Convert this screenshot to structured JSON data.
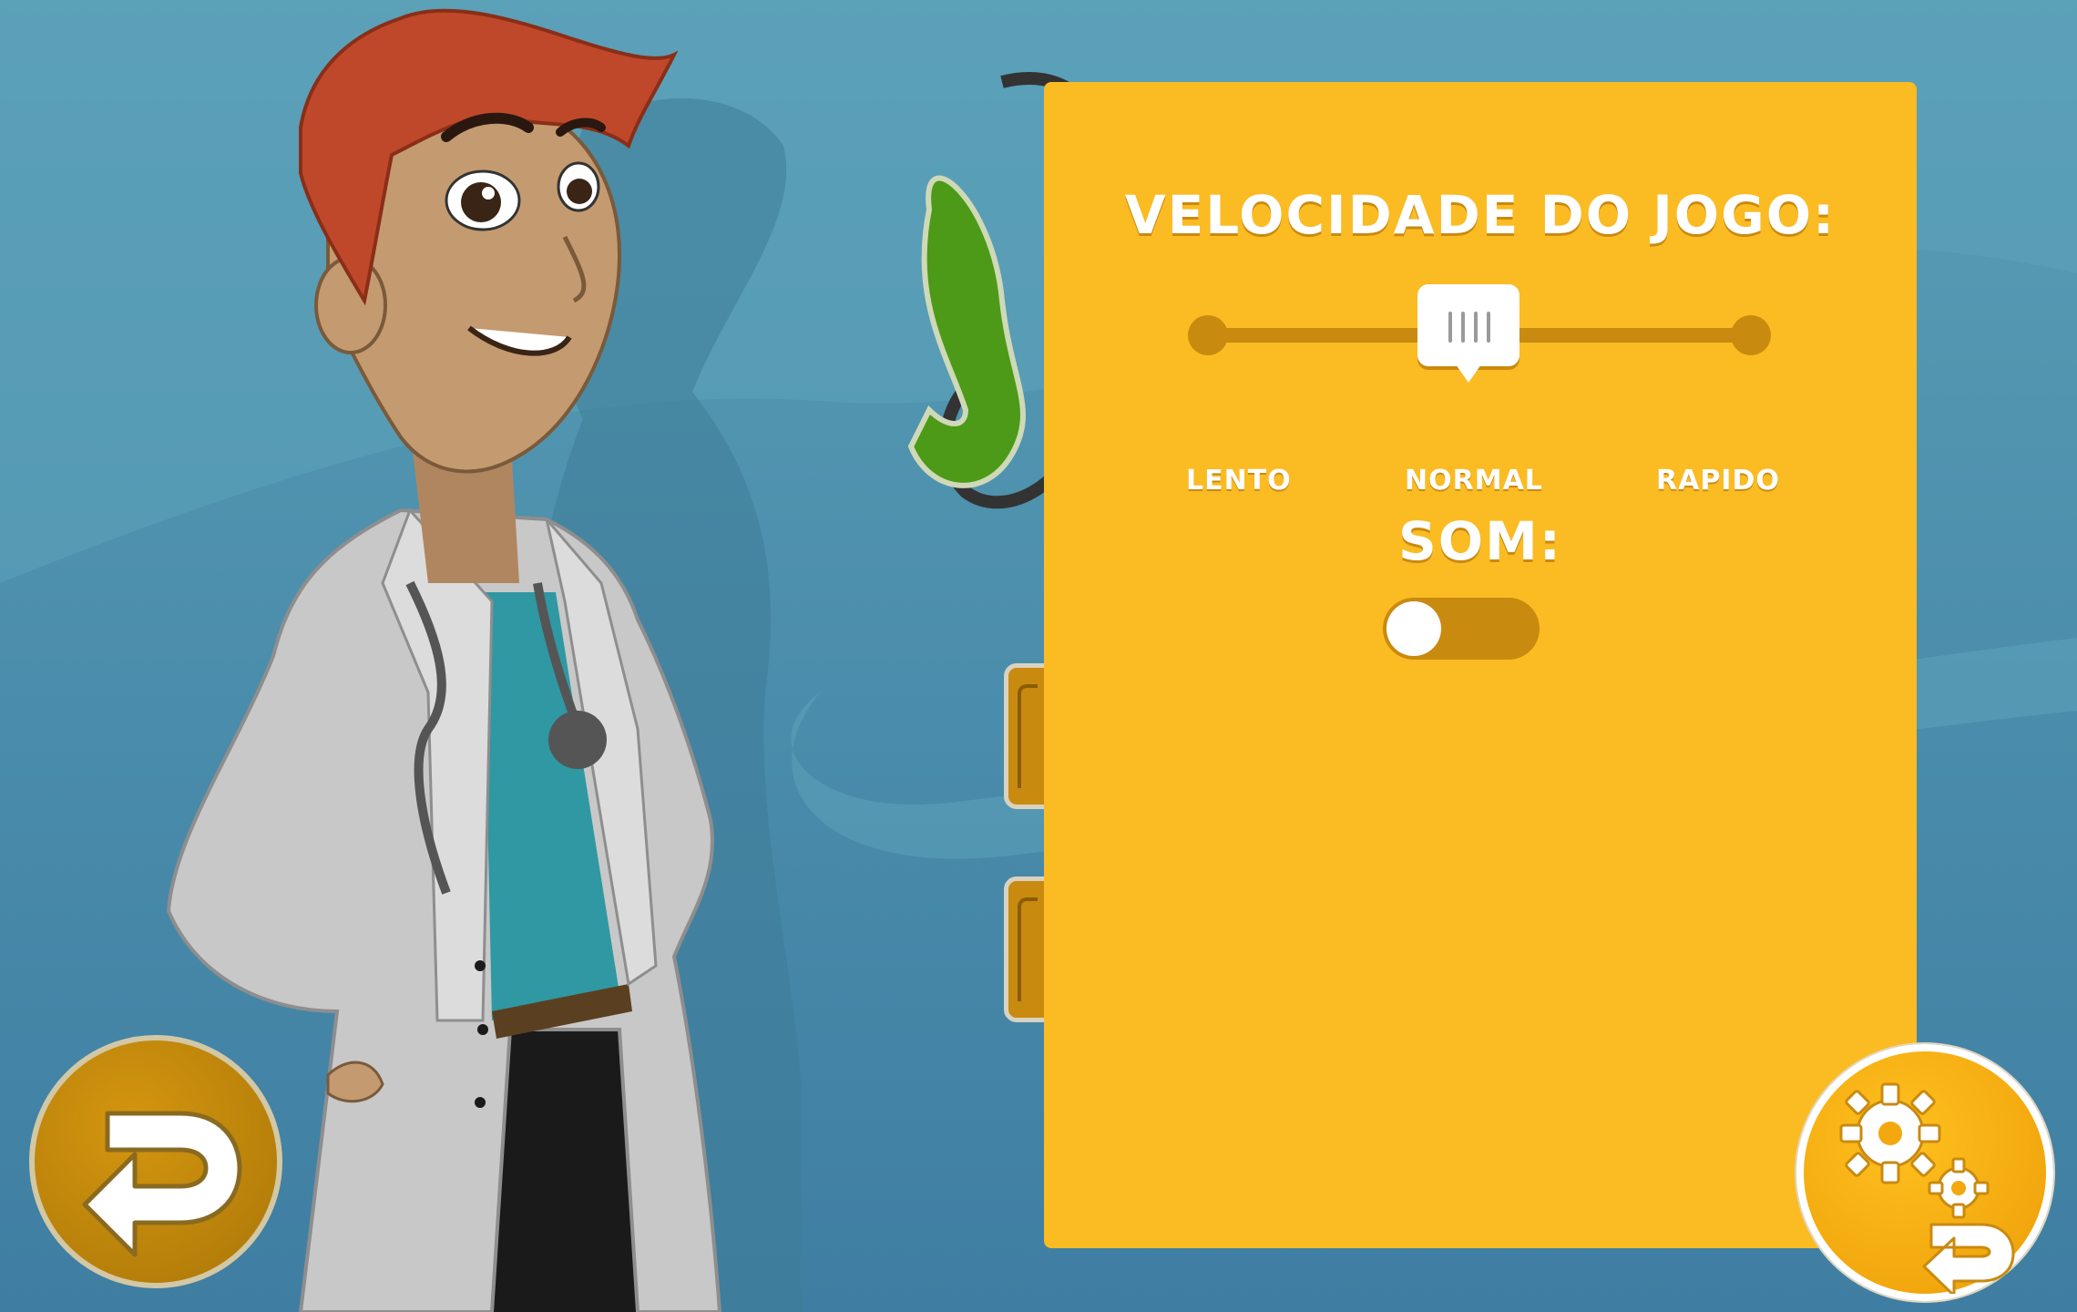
{
  "settings": {
    "speed_title": "VELOCIDADE DO JOGO:",
    "speed_labels": {
      "slow": "LENTO",
      "normal": "NORMAL",
      "fast": "RAPIDO"
    },
    "speed_value": "NORMAL",
    "sound_title": "SOM:",
    "sound_enabled": false
  },
  "icons": {
    "back": "back-arrow-icon",
    "settings": "gears-icon",
    "settings_return": "return-arrow-icon",
    "slider_handle": "slider-grip-icon"
  },
  "colors": {
    "panel": "#fbbb22",
    "accent_dark": "#c98a10",
    "text": "#ffffff",
    "background": "#4a8cab"
  }
}
